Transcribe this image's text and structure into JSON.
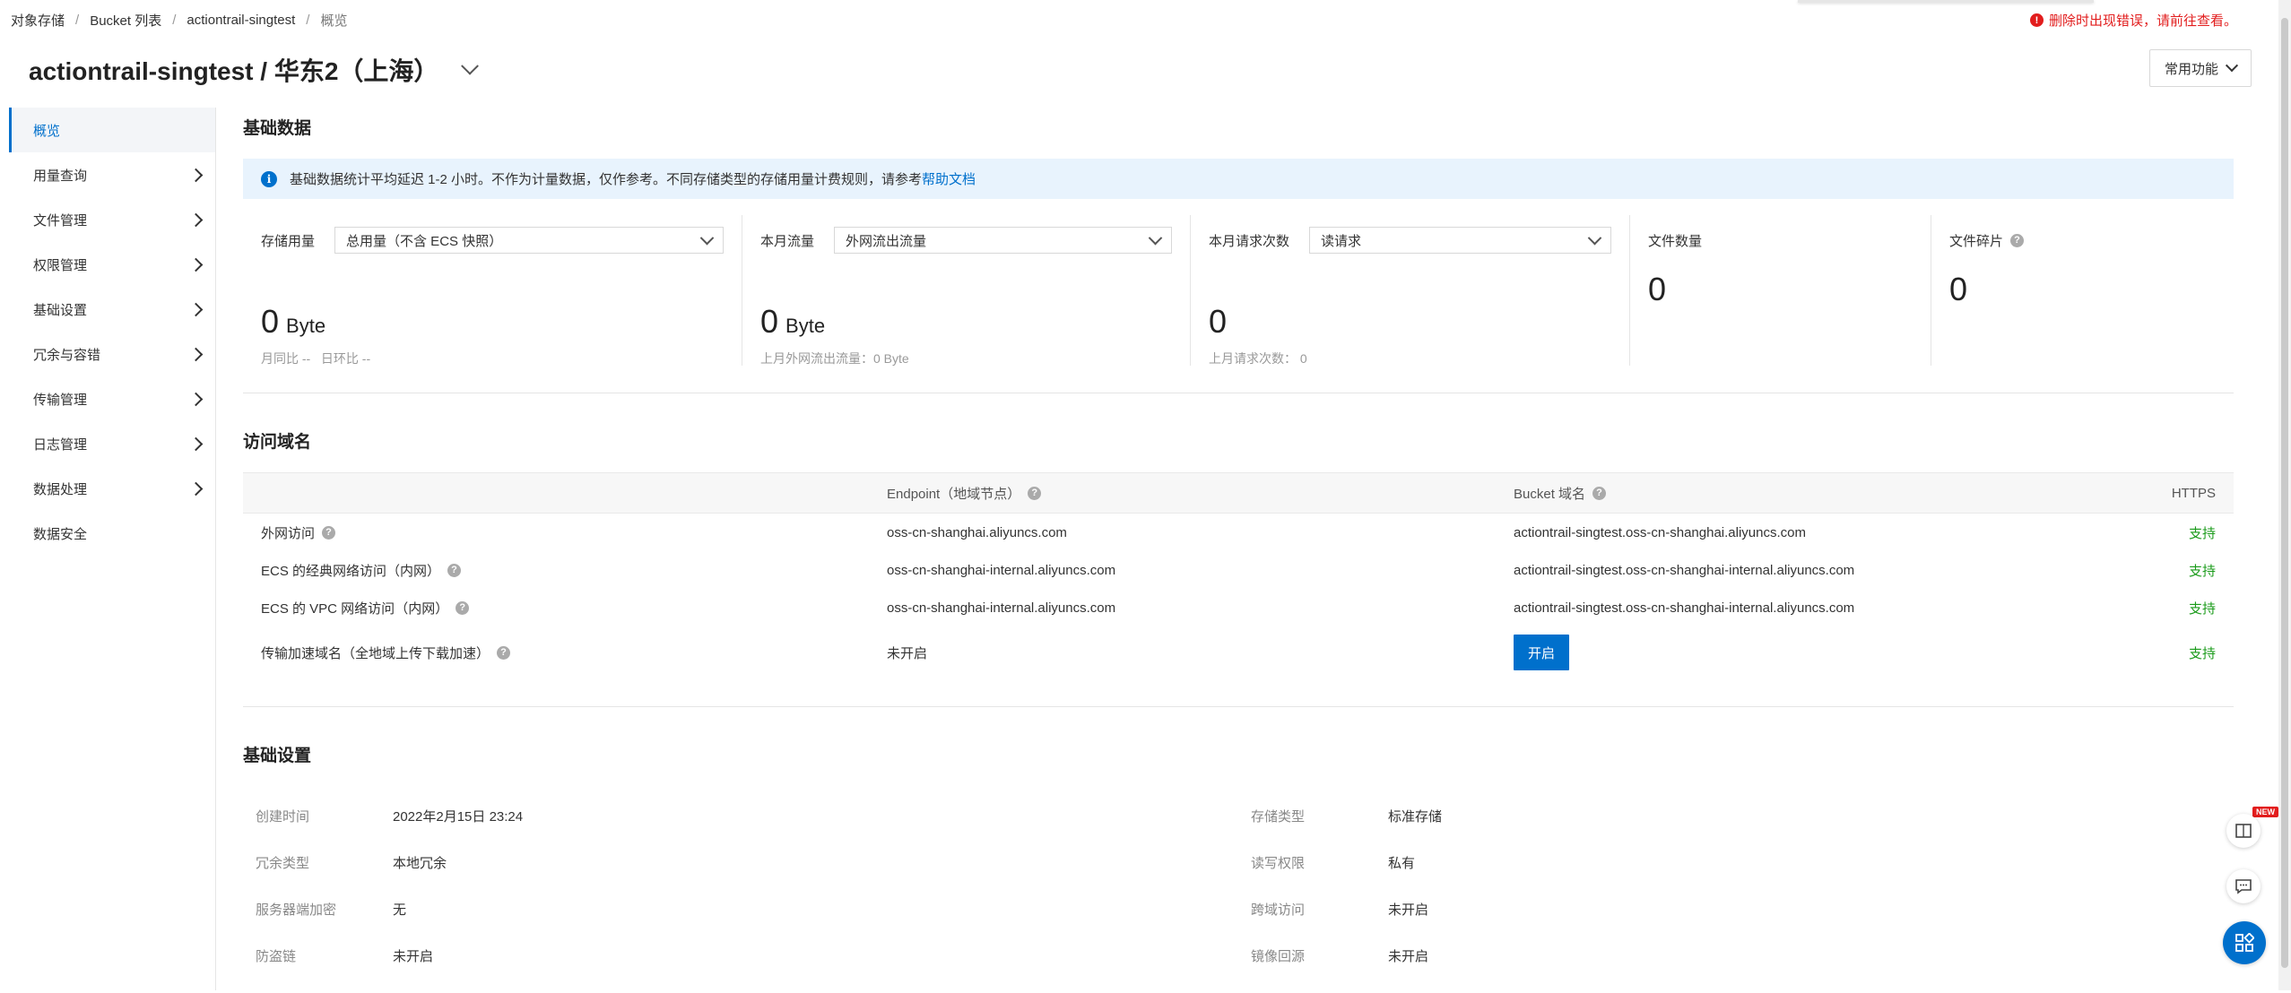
{
  "breadcrumb": [
    "对象存储",
    "Bucket 列表",
    "actiontrail-singtest",
    "概览"
  ],
  "top_warning": "删除时出现错误，请前往查看。",
  "title": "actiontrail-singtest / 华东2（上海）",
  "common_functions": "常用功能",
  "sidebar": {
    "items": [
      {
        "label": "概览",
        "active": true,
        "has_arrow": false
      },
      {
        "label": "用量查询",
        "has_arrow": true
      },
      {
        "label": "文件管理",
        "has_arrow": true
      },
      {
        "label": "权限管理",
        "has_arrow": true
      },
      {
        "label": "基础设置",
        "has_arrow": true
      },
      {
        "label": "冗余与容错",
        "has_arrow": true
      },
      {
        "label": "传输管理",
        "has_arrow": true
      },
      {
        "label": "日志管理",
        "has_arrow": true
      },
      {
        "label": "数据处理",
        "has_arrow": true
      },
      {
        "label": "数据安全",
        "has_arrow": false
      }
    ]
  },
  "basic_data": {
    "title": "基础数据",
    "banner_text": "基础数据统计平均延迟 1-2 小时。不作为计量数据，仅作参考。不同存储类型的存储用量计费规则，请参考",
    "banner_link": "帮助文档",
    "storage": {
      "label": "存储用量",
      "select": "总用量（不含 ECS 快照）",
      "value": "0",
      "unit": "Byte",
      "mom_label": "月同比",
      "mom_value": "--",
      "dod_label": "日环比",
      "dod_value": "--"
    },
    "traffic": {
      "label": "本月流量",
      "select": "外网流出流量",
      "value": "0",
      "unit": "Byte",
      "sub": "上月外网流出流量：0 Byte"
    },
    "requests": {
      "label": "本月请求次数",
      "select": "读请求",
      "value": "0",
      "sub": "上月请求次数：  0"
    },
    "file_count": {
      "label": "文件数量",
      "value": "0"
    },
    "fragments": {
      "label": "文件碎片",
      "value": "0"
    }
  },
  "access_domain": {
    "title": "访问域名",
    "columns": {
      "endpoint": "Endpoint（地域节点）",
      "bucket": "Bucket 域名",
      "https": "HTTPS"
    },
    "rows": [
      {
        "name": "外网访问",
        "endpoint": "oss-cn-shanghai.aliyuncs.com",
        "bucket": "actiontrail-singtest.oss-cn-shanghai.aliyuncs.com",
        "https": "支持"
      },
      {
        "name": "ECS 的经典网络访问（内网）",
        "endpoint": "oss-cn-shanghai-internal.aliyuncs.com",
        "bucket": "actiontrail-singtest.oss-cn-shanghai-internal.aliyuncs.com",
        "https": "支持"
      },
      {
        "name": "ECS 的 VPC 网络访问（内网）",
        "endpoint": "oss-cn-shanghai-internal.aliyuncs.com",
        "bucket": "actiontrail-singtest.oss-cn-shanghai-internal.aliyuncs.com",
        "https": "支持"
      },
      {
        "name": "传输加速域名（全地域上传下载加速）",
        "endpoint": "未开启",
        "button": "开启",
        "https": "支持"
      }
    ]
  },
  "basic_settings": {
    "title": "基础设置",
    "rows": [
      {
        "l1": "创建时间",
        "v1": "2022年2月15日 23:24",
        "l2": "存储类型",
        "v2": "标准存储"
      },
      {
        "l1": "冗余类型",
        "v1": "本地冗余",
        "l2": "读写权限",
        "v2": "私有"
      },
      {
        "l1": "服务器端加密",
        "v1": "无",
        "l2": "跨域访问",
        "v2": "未开启"
      },
      {
        "l1": "防盗链",
        "v1": "未开启",
        "l2": "镜像回源",
        "v2": "未开启"
      }
    ]
  },
  "floating": {
    "new_badge": "NEW"
  },
  "colors": {
    "accent": "#0070cc",
    "success": "#1a9b1a",
    "error": "#e21d1d",
    "banner_bg": "#e8f3fd"
  }
}
